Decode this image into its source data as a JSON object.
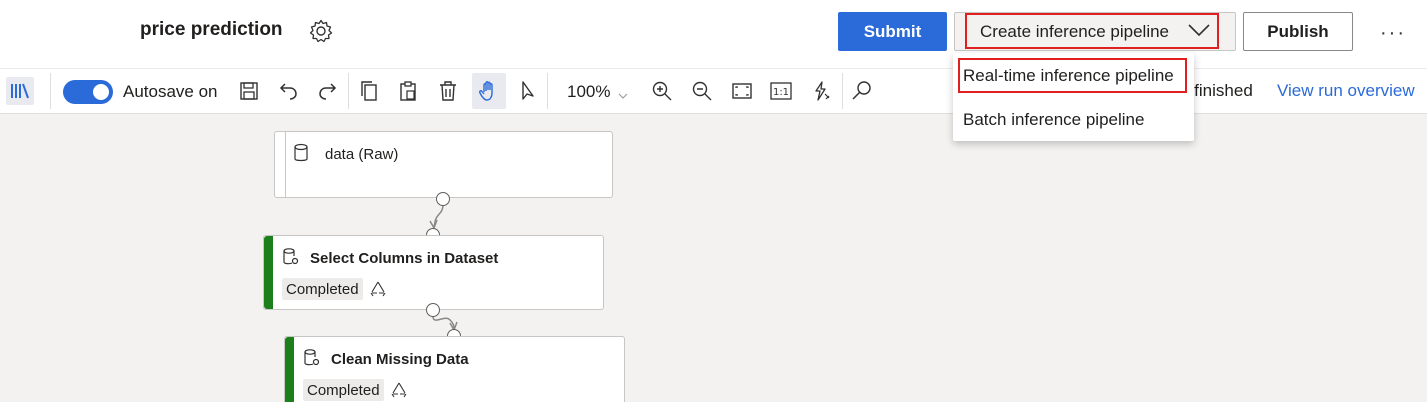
{
  "header": {
    "title": "price prediction",
    "settings_icon": "gear-icon",
    "submit_label": "Submit",
    "create_inference_label": "Create inference pipeline",
    "publish_label": "Publish",
    "more_label": "···"
  },
  "dropdown": {
    "items": [
      {
        "label": "Real-time inference pipeline",
        "highlighted": true
      },
      {
        "label": "Batch inference pipeline",
        "highlighted": false
      }
    ]
  },
  "toolbar": {
    "autosave_label": "Autosave on",
    "autosave_on": true,
    "zoom_value": "100%",
    "run_status": "n finished",
    "view_run_label": "View run overview",
    "fit_label": "1:1",
    "icons": [
      "library-icon",
      "save-icon",
      "undo-icon",
      "redo-icon",
      "copy-icon",
      "paste-icon",
      "delete-icon",
      "pan-hand-icon",
      "select-pointer-icon",
      "zoom-in-icon",
      "zoom-out-icon",
      "fit-screen-icon",
      "actual-size-icon",
      "auto-layout-icon",
      "search-icon"
    ]
  },
  "nodes": [
    {
      "title": "data (Raw)",
      "icon": "dataset-icon"
    },
    {
      "title": "Select Columns in Dataset",
      "icon": "module-icon",
      "status": "Completed",
      "status_icon": "reuse-icon"
    },
    {
      "title": "Clean Missing Data",
      "icon": "module-icon",
      "status": "Completed",
      "status_icon": "reuse-icon"
    }
  ],
  "colors": {
    "accent": "#2a6bd9",
    "highlight": "#e02020",
    "completed": "#1b7f1b"
  }
}
